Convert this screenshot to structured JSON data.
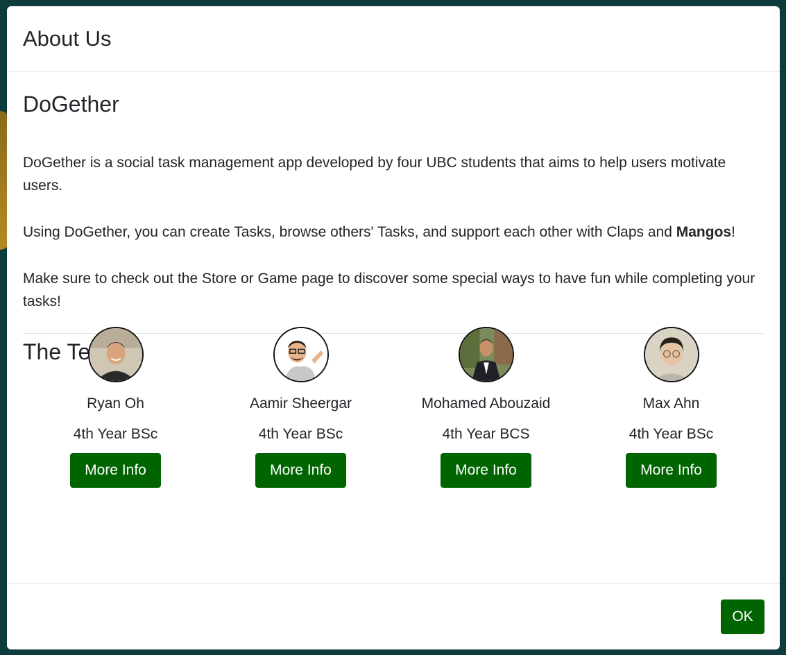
{
  "modal": {
    "title": "About Us"
  },
  "about": {
    "app_name": "DoGether",
    "paragraph1": "DoGether is a social task management app developed by four UBC students that aims to help users motivate users.",
    "paragraph2_before": "Using DoGether, you can create Tasks, browse others' Tasks, and support each other with Claps and ",
    "paragraph2_bold": "Mangos",
    "paragraph2_after": "!",
    "paragraph3": "Make sure to check out the Store or Game page to discover some special ways to have fun while completing your tasks!"
  },
  "team": {
    "title": "The Team",
    "members": [
      {
        "name": "Ryan Oh",
        "year": "4th Year BSc",
        "button": "More Info",
        "avatar": "photo-avatar"
      },
      {
        "name": "Aamir Sheergar",
        "year": "4th Year BSc",
        "button": "More Info",
        "avatar": "cartoon-avatar"
      },
      {
        "name": "Mohamed Abouzaid",
        "year": "4th Year BCS",
        "button": "More Info",
        "avatar": "photo-avatar"
      },
      {
        "name": "Max Ahn",
        "year": "4th Year BSc",
        "button": "More Info",
        "avatar": "photo-avatar"
      }
    ]
  },
  "footer": {
    "ok_label": "OK"
  },
  "colors": {
    "button_green": "#006400",
    "backdrop": "#0e3b3b"
  }
}
